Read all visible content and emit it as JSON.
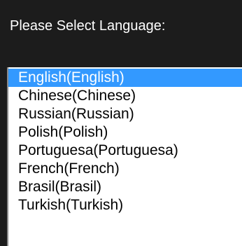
{
  "header": {
    "title": "Please Select Language:"
  },
  "languages": {
    "selected_index": 0,
    "items": [
      "English(English)",
      "Chinese(Chinese)",
      "Russian(Russian)",
      "Polish(Polish)",
      "Portuguesa(Portuguesa)",
      "French(French)",
      "Brasil(Brasil)",
      "Turkish(Turkish)"
    ]
  },
  "colors": {
    "header_bg": "#1c1c1c",
    "selected_bg": "#3399ff",
    "list_bg": "#ffffff"
  }
}
